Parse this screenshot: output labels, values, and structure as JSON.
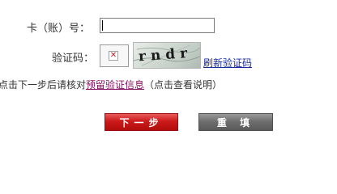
{
  "form": {
    "card_label": "卡（账）号：",
    "card_value": "",
    "captcha_label": "验证码：",
    "captcha_value": "",
    "captcha_text": "rndr",
    "refresh_link": "刷新验证码",
    "info_prefix": "点击下一步后请核对",
    "info_link": "预留验证信息",
    "info_suffix": "（点击查看说明）"
  },
  "buttons": {
    "next": "下一步",
    "reset": "重 填"
  },
  "colors": {
    "next_button": "#cc1a1a",
    "reset_button": "#6f6f6f",
    "refresh_link": "#1a2d9a",
    "info_link": "#86115f"
  },
  "icons": {
    "captcha_placeholder": "broken-image-icon"
  }
}
